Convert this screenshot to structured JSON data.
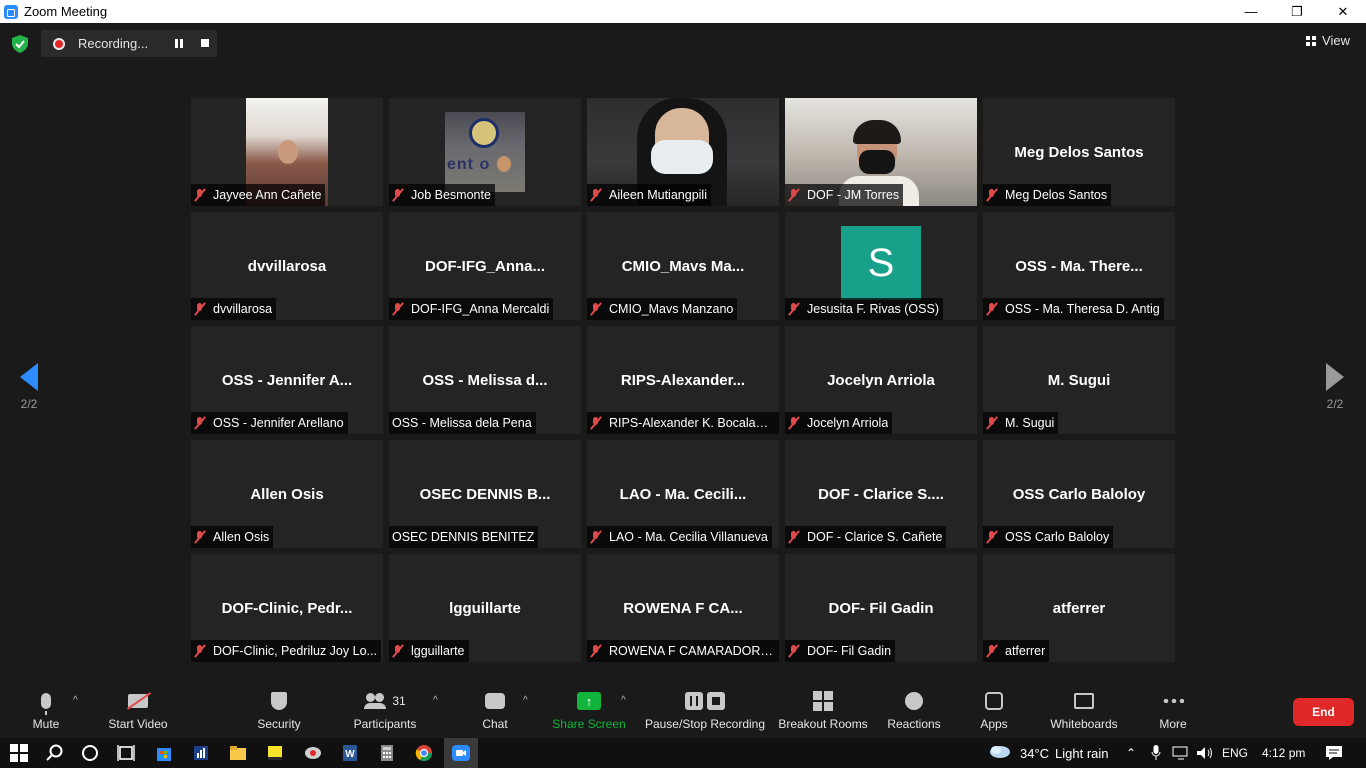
{
  "window": {
    "title": "Zoom Meeting",
    "controls": [
      "—",
      "❐",
      "✕"
    ]
  },
  "topbar": {
    "recording_label": "Recording...",
    "view_label": "View"
  },
  "pagination": {
    "left": "2/2",
    "right": "2/2"
  },
  "tiles": [
    {
      "label": "Jayvee Ann Cañete",
      "display": "",
      "video": "jayvee",
      "muted": true
    },
    {
      "label": "Job Besmonte",
      "display": "",
      "video": "job",
      "muted": true
    },
    {
      "label": "Aileen Mutiangpili",
      "display": "",
      "video": "aileen",
      "muted": true
    },
    {
      "label": "DOF - JM Torres",
      "display": "",
      "video": "jm",
      "muted": true
    },
    {
      "label": "Meg Delos Santos",
      "display": "Meg Delos Santos",
      "video": "",
      "muted": true
    },
    {
      "label": "dvvillarosa",
      "display": "dvvillarosa",
      "video": "",
      "muted": true
    },
    {
      "label": "DOF-IFG_Anna Mercaldi",
      "display": "DOF-IFG_Anna...",
      "video": "",
      "muted": true
    },
    {
      "label": "CMIO_Mavs Manzano",
      "display": "CMIO_Mavs  Ma...",
      "video": "",
      "muted": true
    },
    {
      "label": "Jesusita F. Rivas (OSS)",
      "display": "",
      "video": "avatar",
      "avatar_letter": "S",
      "muted": true
    },
    {
      "label": "OSS - Ma. Theresa D. Antig",
      "display": "OSS - Ma. There...",
      "video": "",
      "muted": true
    },
    {
      "label": "OSS - Jennifer Arellano",
      "display": "OSS - Jennifer A...",
      "video": "",
      "muted": true
    },
    {
      "label": "OSS - Melissa dela Pena",
      "display": "OSS - Melissa d...",
      "video": "",
      "muted": false
    },
    {
      "label": "RIPS-Alexander K. Bocalan,...",
      "display": "RIPS-Alexander...",
      "video": "",
      "muted": true
    },
    {
      "label": "Jocelyn Arriola",
      "display": "Jocelyn Arriola",
      "video": "",
      "muted": true
    },
    {
      "label": "M. Sugui",
      "display": "M. Sugui",
      "video": "",
      "muted": true
    },
    {
      "label": "Allen Osis",
      "display": "Allen Osis",
      "video": "",
      "muted": true
    },
    {
      "label": "OSEC DENNIS BENITEZ",
      "display": "OSEC DENNIS B...",
      "video": "",
      "muted": false
    },
    {
      "label": "LAO - Ma. Cecilia Villanueva",
      "display": "LAO - Ma. Cecili...",
      "video": "",
      "muted": true
    },
    {
      "label": "DOF - Clarice S. Cañete",
      "display": "DOF - Clarice S....",
      "video": "",
      "muted": true
    },
    {
      "label": "OSS Carlo Baloloy",
      "display": "OSS Carlo Baloloy",
      "video": "",
      "muted": true
    },
    {
      "label": "DOF-Clinic, Pedriluz Joy Lo...",
      "display": "DOF-Clinic,  Pedr...",
      "video": "",
      "muted": true
    },
    {
      "label": "lgguillarte",
      "display": "lgguillarte",
      "video": "",
      "muted": true
    },
    {
      "label": "ROWENA F CAMARADOR (...",
      "display": "ROWENA F CA...",
      "video": "",
      "muted": true
    },
    {
      "label": "DOF- Fil Gadin",
      "display": "DOF- Fil Gadin",
      "video": "",
      "muted": true
    },
    {
      "label": "atferrer",
      "display": "atferrer",
      "video": "",
      "muted": true
    }
  ],
  "toolbar": {
    "mute": "Mute",
    "start_video": "Start Video",
    "security": "Security",
    "participants": "Participants",
    "participants_count": "31",
    "chat": "Chat",
    "share_screen": "Share Screen",
    "pause_stop_recording": "Pause/Stop Recording",
    "breakout_rooms": "Breakout Rooms",
    "reactions": "Reactions",
    "apps": "Apps",
    "whiteboards": "Whiteboards",
    "more": "More",
    "end": "End"
  },
  "taskbar": {
    "weather_temp": "34°C",
    "weather_desc": "Light rain",
    "language": "ENG",
    "time": "4:12 pm"
  },
  "colors": {
    "accent": "#2D8CFF",
    "end_red": "#E02828",
    "share_green": "#12B43C",
    "avatar_teal": "#17A08A"
  }
}
